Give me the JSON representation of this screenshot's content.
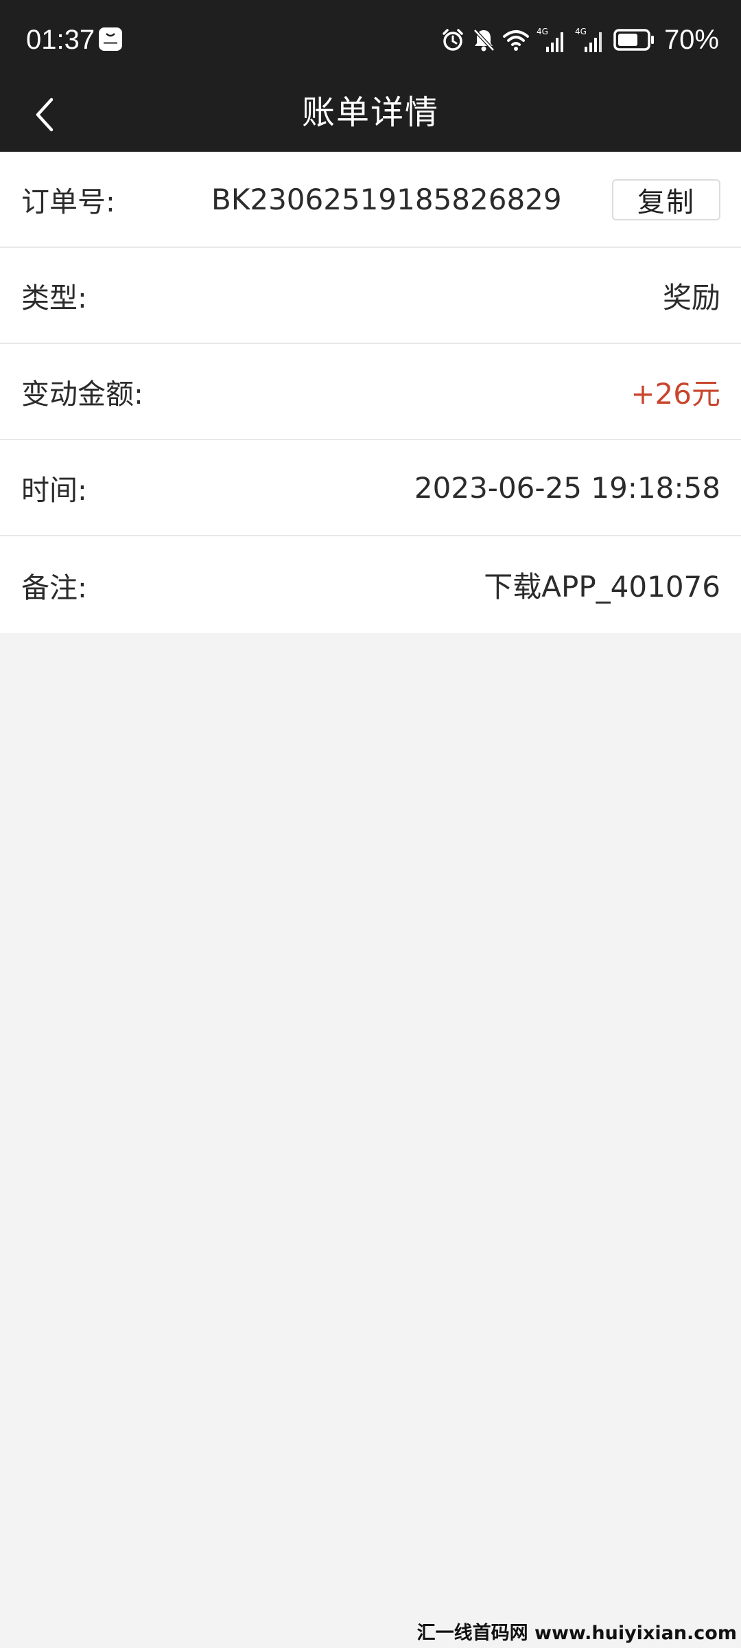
{
  "status_bar": {
    "time": "01:37",
    "battery_percent": "70%",
    "battery_level": 0.7,
    "network_label_1": "4G",
    "network_label_2": "4G"
  },
  "header": {
    "title": "账单详情"
  },
  "details": {
    "order": {
      "label": "订单号:",
      "value": "BK23062519185826829",
      "copy_label": "复制"
    },
    "type": {
      "label": "类型:",
      "value": "奖励"
    },
    "amount": {
      "label": "变动金额:",
      "value": "+26元"
    },
    "time": {
      "label": "时间:",
      "value": "2023-06-25 19:18:58"
    },
    "remark": {
      "label": "备注:",
      "value": "下载APP_401076"
    }
  },
  "watermark": "汇一线首码网 www.huiyixian.com",
  "colors": {
    "header_bg": "#1f1f1f",
    "page_bg": "#f3f3f3",
    "amount_positive": "#c8462d"
  },
  "icons": {
    "back": "chevron-left-icon",
    "alarm": "alarm-icon",
    "mute": "bell-off-icon",
    "wifi": "wifi-icon",
    "signal": "cellular-signal-icon",
    "battery": "battery-icon"
  }
}
